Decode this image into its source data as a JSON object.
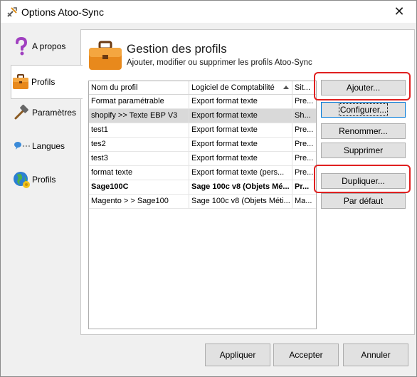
{
  "window": {
    "title": "Options Atoo-Sync",
    "close_glyph": "✕"
  },
  "nav": [
    {
      "label": "A propos",
      "icon": "question-icon"
    },
    {
      "label": "Profils",
      "icon": "briefcase-icon",
      "active": true
    },
    {
      "label": "Paramètres",
      "icon": "hammer-icon"
    },
    {
      "label": "Langues",
      "icon": "speech-icon"
    },
    {
      "label": "Profils",
      "icon": "globe-icon"
    }
  ],
  "header": {
    "title": "Gestion des profils",
    "subtitle": "Ajouter, modifier ou supprimer les profils Atoo-Sync"
  },
  "table": {
    "columns": [
      "Nom du profil",
      "Logiciel de Comptabilité",
      "Sit..."
    ],
    "rows": [
      [
        "Format paramétrable",
        "Export format texte",
        "Pre..."
      ],
      [
        "shopify >> Texte EBP V3",
        "Export format texte",
        "Sh..."
      ],
      [
        "test1",
        "Export format texte",
        "Pre..."
      ],
      [
        "tes2",
        "Export format texte",
        "Pre..."
      ],
      [
        "test3",
        "Export format texte",
        "Pre..."
      ],
      [
        "format texte",
        "Export format texte (pers...",
        "Pre..."
      ],
      [
        "Sage100C",
        "Sage 100c v8 (Objets Mé...",
        "Pr..."
      ],
      [
        "Magento > > Sage100",
        "Sage 100c v8 (Objets Méti...",
        "Ma..."
      ]
    ]
  },
  "buttons": {
    "ajouter": "Ajouter...",
    "configurer": "Configurer...",
    "renommer": "Renommer...",
    "supprimer": "Supprimer",
    "dupliquer": "Dupliquer...",
    "par_defaut": "Par défaut"
  },
  "footer": {
    "appliquer": "Appliquer",
    "accepter": "Accepter",
    "annuler": "Annuler"
  },
  "colors": {
    "highlight": "#e02020",
    "selected_row": "#d9d9d9",
    "focus": "#0078d7"
  }
}
